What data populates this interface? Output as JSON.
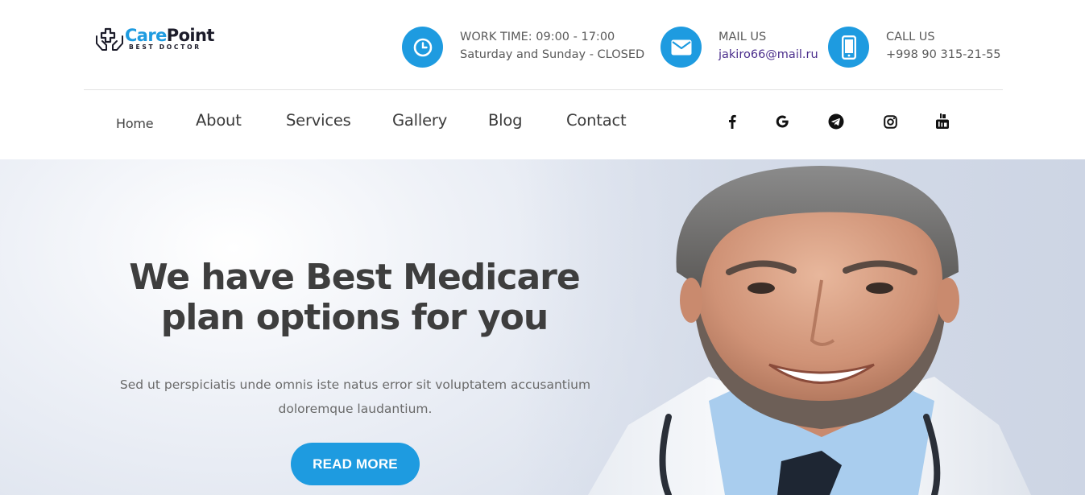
{
  "brand": {
    "name_part1": "Care",
    "name_part2": "Point",
    "tagline": "BEST DOCTOR"
  },
  "contact": {
    "work_title": "WORK TIME: 09:00 - 17:00",
    "work_detail": "Saturday and Sunday - CLOSED",
    "mail_title": "MAIL US",
    "mail_value": "jakiro66@mail.ru",
    "call_title": "CALL US",
    "call_value": "+998 90 315-21-55",
    "icon_work": "clock-icon",
    "icon_mail": "envelope-icon",
    "icon_call": "phone-icon"
  },
  "nav": {
    "items": [
      {
        "label": "Home"
      },
      {
        "label": "About"
      },
      {
        "label": "Services"
      },
      {
        "label": "Gallery"
      },
      {
        "label": "Blog"
      },
      {
        "label": "Contact"
      }
    ],
    "social": [
      "facebook-icon",
      "google-icon",
      "telegram-icon",
      "instagram-icon",
      "youtube-icon"
    ]
  },
  "hero": {
    "title_line1": "We have Best Medicare",
    "title_line2": "plan options for you",
    "text_line1": "Sed ut perspiciatis unde omnis iste natus error sit voluptatem accusantium",
    "text_line2": "doloremque laudantium.",
    "button_label": "READ MORE"
  },
  "colors": {
    "accent": "#1e9be0",
    "dark": "#1c1c2a",
    "link": "#4b2e8c"
  }
}
